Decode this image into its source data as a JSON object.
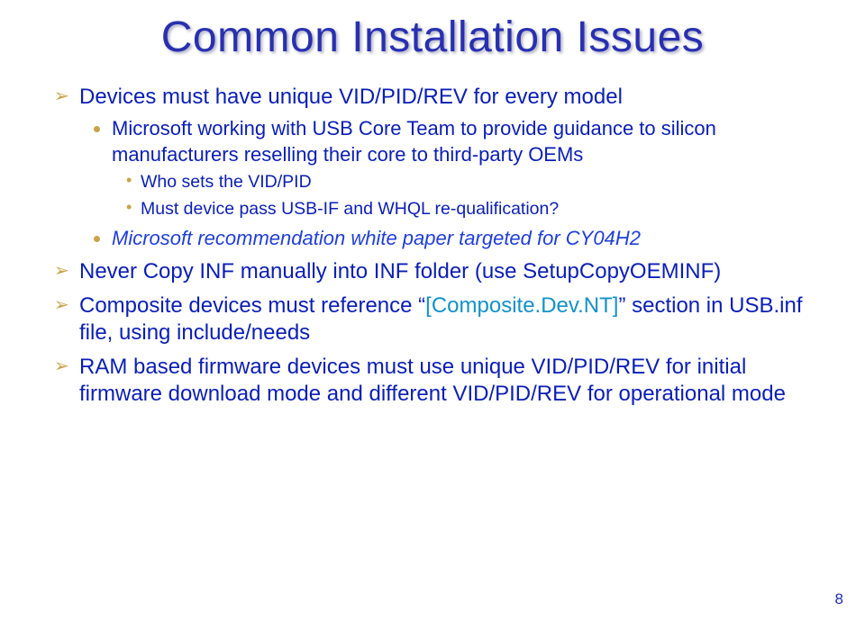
{
  "title": "Common Installation Issues",
  "bullets": {
    "b1": "Devices must have unique VID/PID/REV for every model",
    "b1_1": "Microsoft working with USB Core Team to provide guidance to silicon manufacturers reselling their core to third-party OEMs",
    "b1_1_1": "Who sets the VID/PID",
    "b1_1_2": "Must device pass USB-IF and WHQL re-qualification?",
    "b1_2": "Microsoft recommendation white paper targeted for CY04H2",
    "b2": "Never Copy INF manually into INF folder (use SetupCopyOEMINF)",
    "b3_pre": "Composite devices must reference “",
    "b3_hl": "[Composite.Dev.NT]",
    "b3_post": "” section in USB.inf file, using include/needs",
    "b4": "RAM based firmware devices must use unique VID/PID/REV for initial firmware download mode and different VID/PID/REV for operational mode"
  },
  "page_number": "8"
}
